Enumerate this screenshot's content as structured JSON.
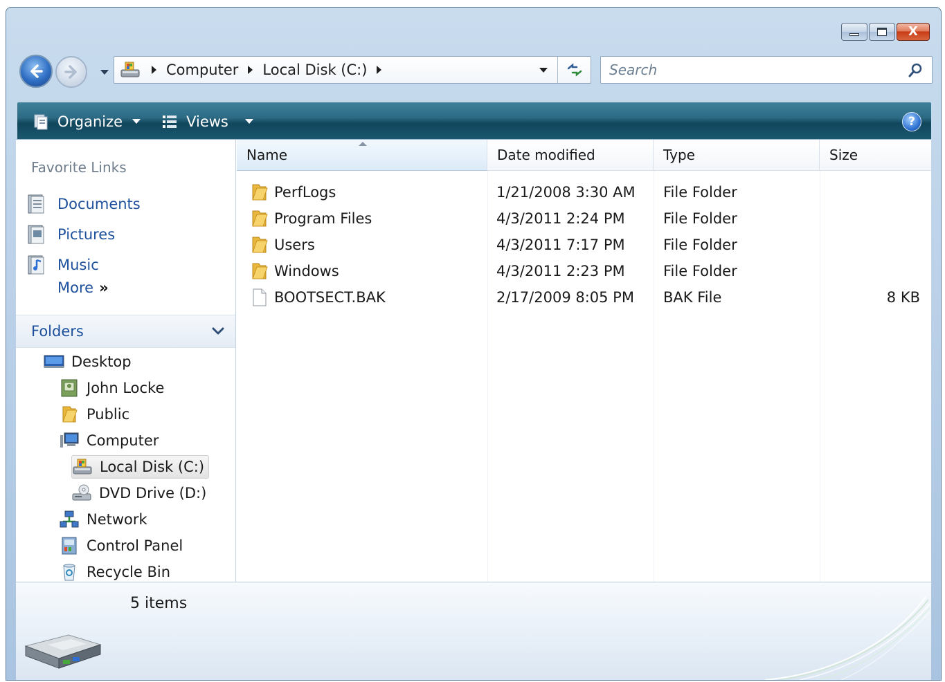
{
  "window": {
    "controls": {
      "minimize": "minimize",
      "maximize": "maximize",
      "close": "X"
    }
  },
  "navigation": {
    "breadcrumbs": [
      "Computer",
      "Local Disk (C:)"
    ],
    "search_placeholder": "Search"
  },
  "command_bar": {
    "organize_label": "Organize",
    "views_label": "Views",
    "help_label": "?"
  },
  "nav_pane": {
    "favorite_links_heading": "Favorite Links",
    "favorites": [
      {
        "label": "Documents",
        "icon": "documents-icon"
      },
      {
        "label": "Pictures",
        "icon": "pictures-icon"
      },
      {
        "label": "Music",
        "icon": "music-icon"
      }
    ],
    "more_label": "More",
    "more_chevron": "»",
    "folders_heading": "Folders",
    "tree": [
      {
        "label": "Desktop",
        "icon": "desktop-icon"
      },
      {
        "label": "John Locke",
        "icon": "user-folder-icon"
      },
      {
        "label": "Public",
        "icon": "folder-icon"
      },
      {
        "label": "Computer",
        "icon": "computer-icon"
      },
      {
        "label": "Local Disk (C:)",
        "icon": "local-disk-icon",
        "selected": true
      },
      {
        "label": "DVD Drive (D:)",
        "icon": "dvd-drive-icon"
      },
      {
        "label": "Network",
        "icon": "network-icon"
      },
      {
        "label": "Control Panel",
        "icon": "control-panel-icon"
      },
      {
        "label": "Recycle Bin",
        "icon": "recycle-bin-icon"
      }
    ]
  },
  "file_list": {
    "columns": [
      "Name",
      "Date modified",
      "Type",
      "Size"
    ],
    "sorted_column": "Name",
    "rows": [
      {
        "name": "PerfLogs",
        "date": "1/21/2008 3:30 AM",
        "type": "File Folder",
        "size": "",
        "icon": "folder-icon"
      },
      {
        "name": "Program Files",
        "date": "4/3/2011 2:24 PM",
        "type": "File Folder",
        "size": "",
        "icon": "folder-icon"
      },
      {
        "name": "Users",
        "date": "4/3/2011 7:17 PM",
        "type": "File Folder",
        "size": "",
        "icon": "folder-icon"
      },
      {
        "name": "Windows",
        "date": "4/3/2011 2:23 PM",
        "type": "File Folder",
        "size": "",
        "icon": "folder-icon"
      },
      {
        "name": "BOOTSECT.BAK",
        "date": "2/17/2009 8:05 PM",
        "type": "BAK File",
        "size": "8 KB",
        "icon": "file-icon"
      }
    ]
  },
  "details_pane": {
    "item_count": "5 items"
  },
  "colors": {
    "link": "#1c4f9c",
    "command_bar": "#1b5a70",
    "frame": "#b5cde6"
  }
}
